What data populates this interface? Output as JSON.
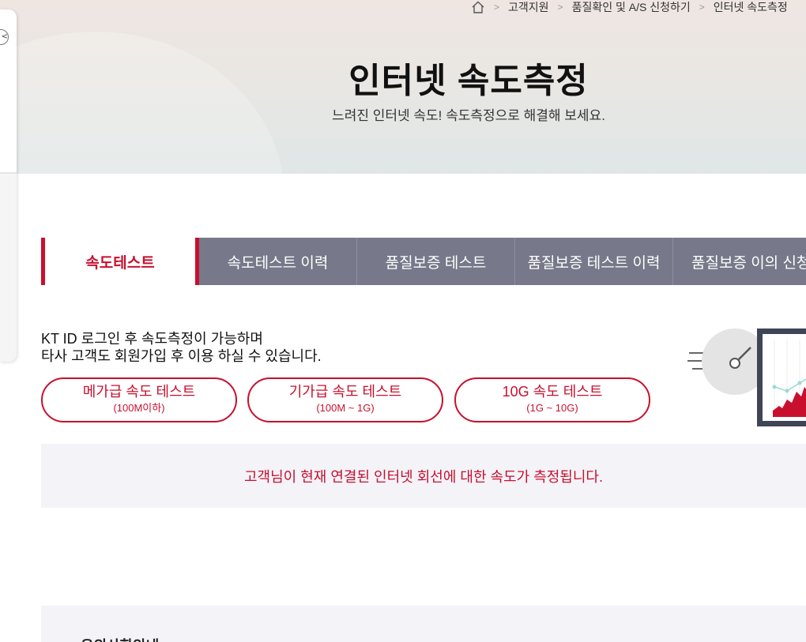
{
  "breadcrumb": {
    "items": [
      "고객지원",
      "품질확인 및 A/S 신청하기",
      "인터넷 속도측정"
    ]
  },
  "header": {
    "title": "인터넷 속도측정",
    "subtitle": "느려진 인터넷 속도! 속도측정으로 해결해 보세요."
  },
  "tabs": [
    {
      "label": "속도테스트",
      "active": true
    },
    {
      "label": "속도테스트 이력",
      "active": false
    },
    {
      "label": "품질보증 테스트",
      "active": false
    },
    {
      "label": "품질보증 테스트 이력",
      "active": false
    },
    {
      "label": "품질보증 이의 신청",
      "active": false
    }
  ],
  "notice": {
    "line1": "KT ID 로그인 후 속도측정이 가능하며",
    "line2": "타사 고객도 회원가입 후 이용 하실 수 있습니다."
  },
  "speed_buttons": [
    {
      "label": "메가급 속도 테스트",
      "sub": "(100M이하)"
    },
    {
      "label": "기가급 속도 테스트",
      "sub": "(100M ~ 1G)"
    },
    {
      "label": "10G 속도 테스트",
      "sub": "(1G ~ 10G)"
    }
  ],
  "info": {
    "text": "고객님이 현재 연결된 인터넷 회선에 대한 속도가 측정됩니다."
  },
  "bottom": {
    "title": "유의사항안내"
  },
  "colors": {
    "accent": "#c8102e",
    "tab_bg": "#77798a",
    "panel_bg": "#f3f3f8"
  }
}
